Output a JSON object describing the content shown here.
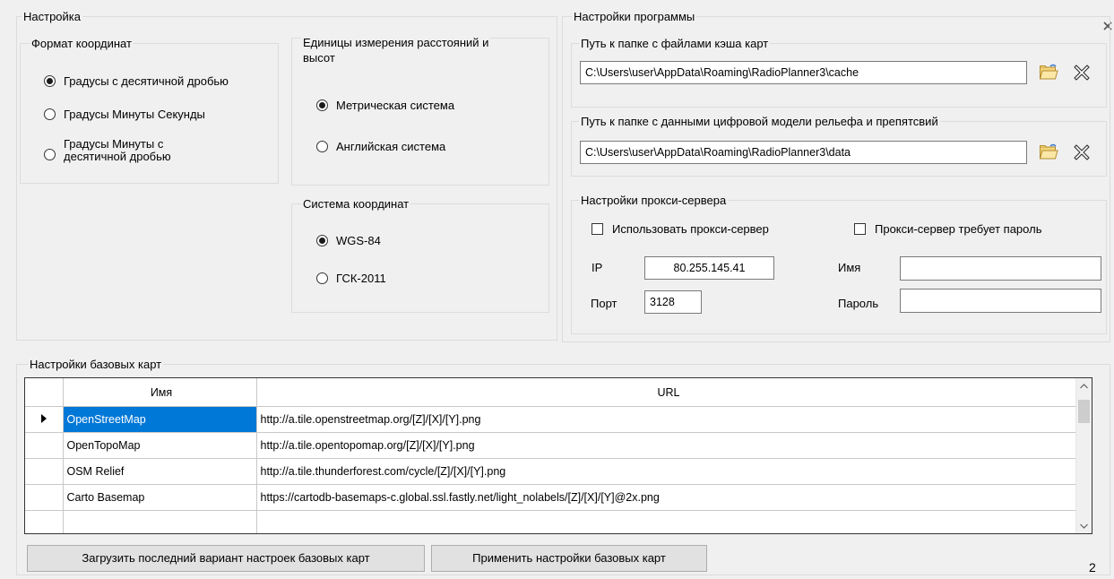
{
  "close_icon": "close-icon",
  "settings": {
    "legend": "Настройка",
    "coord_format": {
      "legend": "Формат координат",
      "options": [
        "Градусы с десятичной дробью",
        "Градусы Минуты Секунды",
        "Градусы Минуты с",
        "десятичной дробью"
      ],
      "selected": 0
    },
    "units": {
      "legend_line1": "Единицы измерения расстояний и",
      "legend_line2": "высот",
      "options": [
        "Метрическая система",
        "Английская система"
      ],
      "selected": 0
    },
    "coord_system": {
      "legend": "Система координат",
      "options": [
        "WGS-84",
        "ГСК-2011"
      ],
      "selected": 0
    }
  },
  "program": {
    "legend": "Настройки программы",
    "cache": {
      "legend": "Путь к папке с файлами кэша карт",
      "path": "C:\\Users\\user\\AppData\\Roaming\\RadioPlanner3\\cache"
    },
    "dem": {
      "legend": "Путь к папке с данными цифровой модели рельефа и препятсвий",
      "path": "C:\\Users\\user\\AppData\\Roaming\\RadioPlanner3\\data"
    },
    "proxy": {
      "legend": "Настройки прокси-сервера",
      "use_proxy_label": "Использовать прокси-сервер",
      "requires_password_label": "Прокси-сервер требует пароль",
      "use_proxy": false,
      "requires_password": false,
      "ip_label": "IP",
      "ip_value": "80.255.145.41",
      "port_label": "Порт",
      "port_value": "3128",
      "name_label": "Имя",
      "name_value": "",
      "password_label": "Пароль",
      "password_value": ""
    }
  },
  "basemaps": {
    "legend": "Настройки базовых карт",
    "columns": [
      "Имя",
      "URL"
    ],
    "rows": [
      {
        "name": "OpenStreetMap",
        "url": "http://a.tile.openstreetmap.org/[Z]/[X]/[Y].png"
      },
      {
        "name": "OpenTopoMap",
        "url": "http://a.tile.opentopomap.org/[Z]/[X]/[Y].png"
      },
      {
        "name": "OSM Relief",
        "url": "http://a.tile.thunderforest.com/cycle/[Z]/[X]/[Y].png"
      },
      {
        "name": "Carto Basemap",
        "url": "https://cartodb-basemaps-c.global.ssl.fastly.net/light_nolabels/[Z]/[X]/[Y]@2x.png"
      }
    ],
    "selected_row": 0,
    "load_button": "Загрузить последний вариант настроек базовых карт",
    "apply_button": "Применить настройки базовых карт"
  },
  "page_number": "2"
}
